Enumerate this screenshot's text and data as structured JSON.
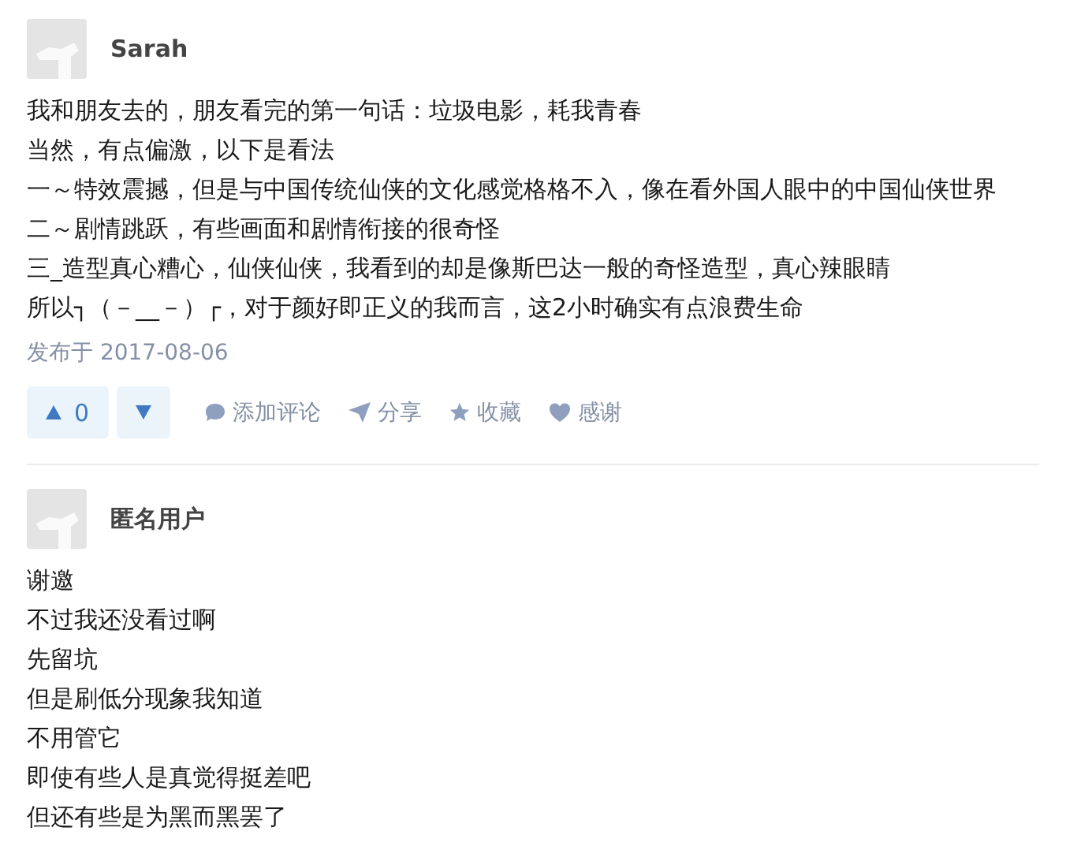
{
  "answers": [
    {
      "author": "Sarah",
      "lines": [
        "我和朋友去的，朋友看完的第一句话：垃圾电影，耗我青春",
        "当然，有点偏激，以下是看法",
        "一～特效震撼，但是与中国传统仙侠的文化感觉格格不入，像在看外国人眼中的中国仙侠世界",
        "二～剧情跳跃，有些画面和剧情衔接的很奇怪",
        "三_造型真心糟心，仙侠仙侠，我看到的却是像斯巴达一般的奇怪造型，真心辣眼睛",
        "所以┐（－__－）┌，对于颜好即正义的我而言，这2小时确实有点浪费生命"
      ],
      "date": "发布于 2017-08-06",
      "votes": "0",
      "actions": [
        {
          "kind": "comment",
          "label": "添加评论"
        },
        {
          "kind": "share",
          "label": "分享"
        },
        {
          "kind": "star",
          "label": "收藏"
        },
        {
          "kind": "heart",
          "label": "感谢"
        }
      ]
    },
    {
      "author": "匿名用户",
      "lines": [
        "谢邀",
        "不过我还没看过啊",
        "先留坑",
        "但是刷低分现象我知道",
        "不用管它",
        "即使有些人是真觉得挺差吧",
        "但还有些是为黑而黑罢了"
      ]
    }
  ]
}
